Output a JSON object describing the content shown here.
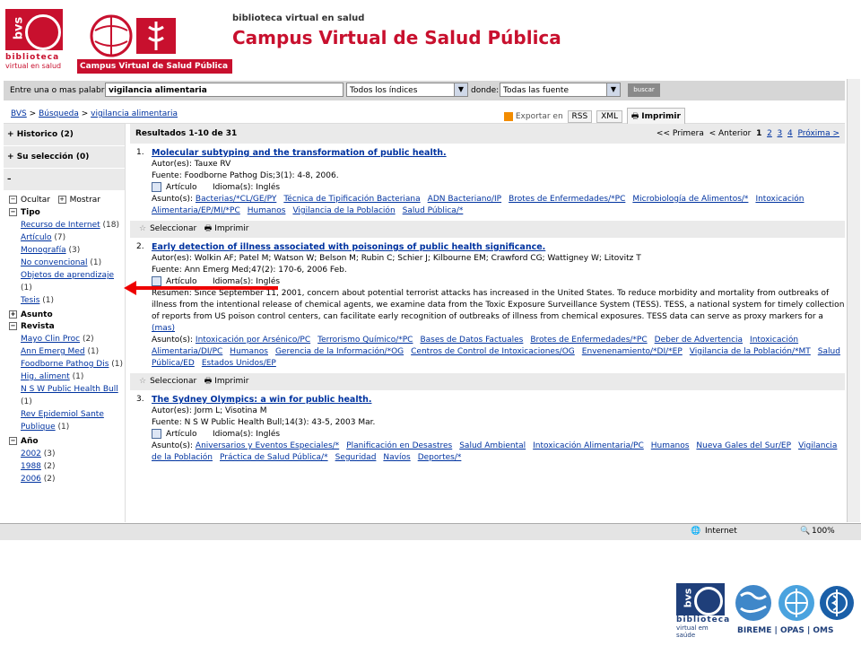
{
  "header": {
    "bvs_logo_text": "bvs",
    "bvs_line1": "biblioteca",
    "bvs_line2": "virtual en salud",
    "campus_subtitle": "Campus Virtual de Salud Pública",
    "small_title": "biblioteca virtual en salud",
    "main_title": "Campus Virtual de Salud Pública"
  },
  "search": {
    "label": "Entre una o mas palabras",
    "query": "vigilancia alimentaria",
    "index_value": "Todos los índices",
    "donde_label": "donde:",
    "source_value": "Todas las fuente",
    "button": "buscar"
  },
  "breadcrumb": {
    "items": [
      "BVS",
      "Búsqueda",
      "vigilancia alimentaria"
    ],
    "sep": ">"
  },
  "export": {
    "label": "Exportar en",
    "rss": "RSS",
    "xml": "XML",
    "print": "Imprimir"
  },
  "sidebar": {
    "historico": "Historico",
    "historico_count": "(2)",
    "seleccion": "Su selección",
    "seleccion_count": "(0)",
    "minus": "–",
    "ocultar": "Ocultar",
    "mostrar": "Mostrar",
    "tipo": "Tipo",
    "tipo_items": [
      {
        "label": "Recurso de Internet",
        "count": "(18)"
      },
      {
        "label": "Artículo",
        "count": "(7)"
      },
      {
        "label": "Monografía",
        "count": "(3)"
      },
      {
        "label": "No convencional",
        "count": "(1)"
      },
      {
        "label": "Objetos de aprendizaje",
        "count": "(1)"
      },
      {
        "label": "Tesis",
        "count": "(1)"
      }
    ],
    "asunto": "Asunto",
    "revista": "Revista",
    "revista_items": [
      {
        "label": "Mayo Clin Proc",
        "count": "(2)"
      },
      {
        "label": "Ann Emerg Med",
        "count": "(1)"
      },
      {
        "label": "Foodborne Pathog Dis",
        "count": "(1)"
      },
      {
        "label": "Hig. aliment",
        "count": "(1)"
      },
      {
        "label": "N S W Public Health Bull",
        "count": "(1)"
      },
      {
        "label": "Rev Epidemiol Sante Publique",
        "count": "(1)"
      }
    ],
    "ano": "Año",
    "ano_items": [
      {
        "label": "2002",
        "count": "(3)"
      },
      {
        "label": "1988",
        "count": "(2)"
      },
      {
        "label": "2006",
        "count": "(2)"
      }
    ]
  },
  "results": {
    "summary": "Resultados 1-10 de 31",
    "pager": {
      "first": "<< Primera",
      "prev": "< Anterior",
      "pages": [
        "1",
        "2",
        "3",
        "4"
      ],
      "next": "Próxima >"
    },
    "select_label": "Seleccionar",
    "print_label": "Imprimir",
    "records": [
      {
        "num": "1.",
        "title": "Molecular subtyping and the transformation of public health.",
        "authors": "Autor(es): Tauxe RV",
        "source": "Fuente: Foodborne Pathog Dis;3(1): 4-8, 2006.",
        "type": "Artículo",
        "lang": "Idioma(s): Inglés",
        "subject_label": "Asunto(s):",
        "subjects": [
          "Bacterias/*CL/GE/PY",
          "Técnica de Tipificación Bacteriana",
          "ADN Bacteriano/IP",
          "Brotes de Enfermedades/*PC",
          "Microbiología de Alimentos/*",
          "Intoxicación Alimentaria/EP/MI/*PC",
          "Humanos",
          "Vigilancia de la Población",
          "Salud Pública/*"
        ]
      },
      {
        "num": "2.",
        "title": "Early detection of illness associated with poisonings of public health significance.",
        "authors": "Autor(es): Wolkin AF; Patel M; Watson W; Belson M; Rubin C; Schier J; Kilbourne EM; Crawford CG; Wattigney W; Litovitz T",
        "source": "Fuente: Ann Emerg Med;47(2): 170-6, 2006 Feb.",
        "type": "Artículo",
        "lang": "Idioma(s): Inglés",
        "abstract": "Resumen: Since September 11, 2001, concern about potential terrorist attacks has increased in the United States. To reduce morbidity and mortality from outbreaks of illness from the intentional release of chemical agents, we examine data from the Toxic Exposure Surveillance System (TESS). TESS, a national system for timely collection of reports from US poison control centers, can facilitate early recognition of outbreaks of illness from chemical exposures. TESS data can serve as proxy markers for a",
        "more": "(mas)",
        "subject_label": "Asunto(s):",
        "subjects": [
          "Intoxicación por Arsénico/PC",
          "Terrorismo Químico/*PC",
          "Bases de Datos Factuales",
          "Brotes de Enfermedades/*PC",
          "Deber de Advertencia",
          "Intoxicación Alimentaria/DI/PC",
          "Humanos",
          "Gerencia de la Información/*OG",
          "Centros de Control de Intoxicaciones/OG",
          "Envenenamiento/*DI/*EP",
          "Vigilancia de la Población/*MT",
          "Salud Pública/ED",
          "Estados Unidos/EP"
        ]
      },
      {
        "num": "3.",
        "title": "The Sydney Olympics: a win for public health.",
        "authors": "Autor(es): Jorm L; Visotina M",
        "source": "Fuente: N S W Public Health Bull;14(3): 43-5, 2003 Mar.",
        "type": "Artículo",
        "lang": "Idioma(s): Inglés",
        "subject_label": "Asunto(s):",
        "subjects": [
          "Aniversarios y Eventos Especiales/*",
          "Planificación en Desastres",
          "Salud Ambiental",
          "Intoxicación Alimentaria/PC",
          "Humanos",
          "Nueva Gales del Sur/EP",
          "Vigilancia de la Población",
          "Práctica de Salud Pública/*",
          "Seguridad",
          "Navíos",
          "Deportes/*"
        ]
      }
    ]
  },
  "statusbar": {
    "zone": "Internet",
    "zoom": "100%"
  },
  "footer_logos": {
    "bvs_text": "bvs",
    "bvs_line1": "biblioteca",
    "bvs_line2": "virtual em saúde",
    "orgs": "BIREME | OPAS | OMS"
  },
  "colors": {
    "brand_red": "#c8102e",
    "link_blue": "#0033a0",
    "annotation_arrow": "#e00000"
  }
}
